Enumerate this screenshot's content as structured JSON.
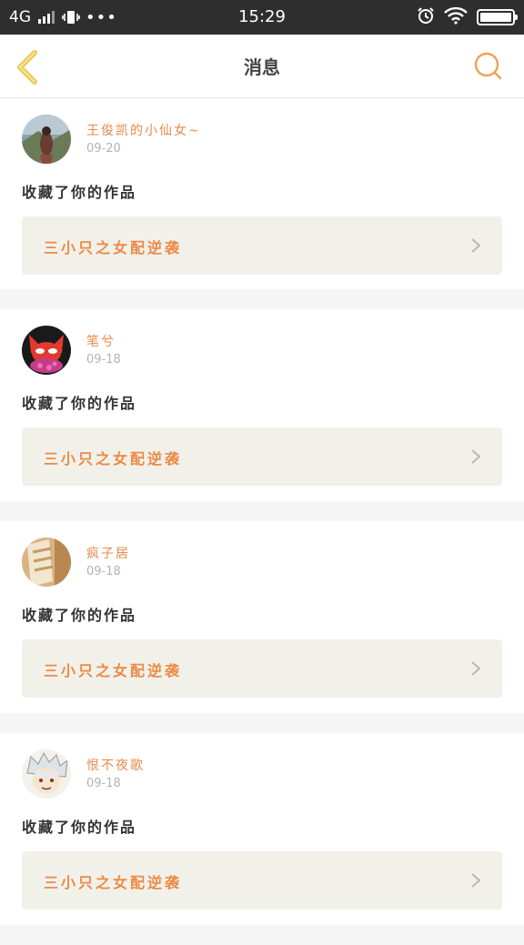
{
  "status_bar": {
    "network": "4G",
    "time": "15:29",
    "icons": [
      "signal-icon",
      "vibrate-icon",
      "more-dots-icon",
      "alarm-icon",
      "wifi-icon",
      "battery-icon"
    ]
  },
  "header": {
    "title": "消息",
    "back_icon": "chevron-left-icon",
    "search_icon": "search-icon",
    "accent_color": "#e8a94f"
  },
  "messages": [
    {
      "username": "王俊凯的小仙女~",
      "date": "09-20",
      "action": "收藏了你的作品",
      "work_title": "三小只之女配逆袭"
    },
    {
      "username": "笔兮",
      "date": "09-18",
      "action": "收藏了你的作品",
      "work_title": "三小只之女配逆袭"
    },
    {
      "username": "疯子居",
      "date": "09-18",
      "action": "收藏了你的作品",
      "work_title": "三小只之女配逆袭"
    },
    {
      "username": "恨不夜歌",
      "date": "09-18",
      "action": "收藏了你的作品",
      "work_title": "三小只之女配逆袭"
    }
  ],
  "colors": {
    "username": "#e8894a",
    "work_title": "#ec8a45",
    "work_bg": "#f1f1ea",
    "page_bg": "#f5f5f5"
  }
}
